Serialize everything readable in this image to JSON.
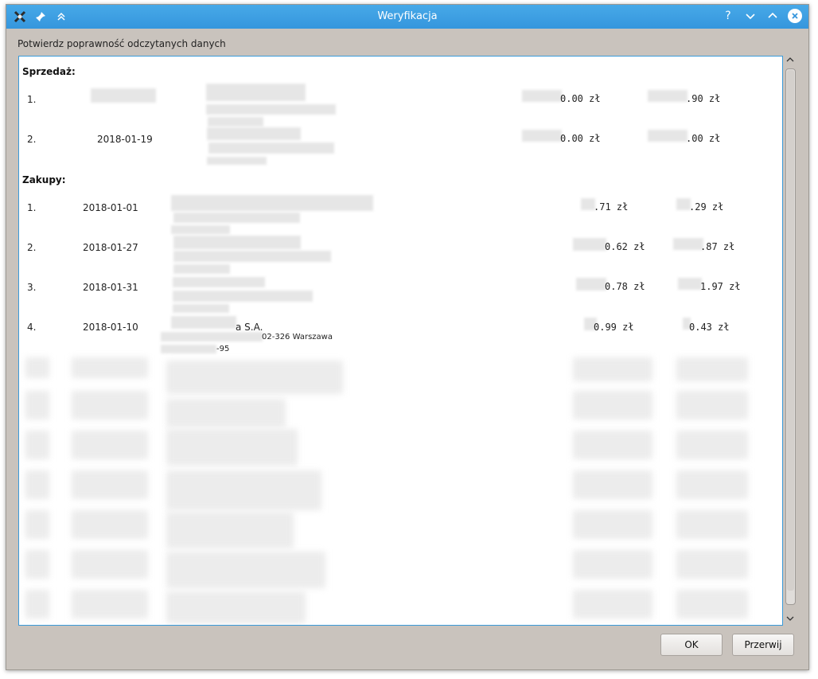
{
  "window": {
    "title": "Weryfikacja"
  },
  "subtitle": "Potwierdz poprawność odczytanych danych",
  "sections": {
    "sales": {
      "title": "Sprzedaż:",
      "rows": [
        {
          "num": "1.",
          "date": "",
          "amount_net": "0.00 zł",
          "amount_gross": ".90 zł"
        },
        {
          "num": "2.",
          "date": "2018-01-19",
          "amount_net": "0.00 zł",
          "amount_gross": ".00 zł"
        }
      ]
    },
    "purchases": {
      "title": "Zakupy:",
      "rows": [
        {
          "num": "1.",
          "date": "2018-01-01",
          "amount_net": ".71 zł",
          "amount_gross": ".29 zł"
        },
        {
          "num": "2.",
          "date": "2018-01-27",
          "amount_net": "0.62 zł",
          "amount_gross": ".87 zł"
        },
        {
          "num": "3.",
          "date": "2018-01-31",
          "amount_net": "0.78 zł",
          "amount_gross": "1.97 zł"
        },
        {
          "num": "4.",
          "date": "2018-01-10",
          "company": "a S.A.",
          "address": "02-326 Warszawa",
          "nip": "-95",
          "amount_net": "0.99 zł",
          "amount_gross": "0.43 zł"
        }
      ]
    }
  },
  "buttons": {
    "ok": "OK",
    "cancel": "Przerwij"
  },
  "titlebar_icons": {
    "app": "kde-app-icon",
    "pin": "pin-icon",
    "keep_above": "keep-above-icon",
    "help": "?",
    "minimize": "chevron-down-icon",
    "maximize": "chevron-up-icon",
    "close": "close-icon"
  },
  "colors": {
    "titlebar": "#3596dd",
    "window_bg": "#c9c3bd",
    "focus_border": "#3a9ad9"
  }
}
